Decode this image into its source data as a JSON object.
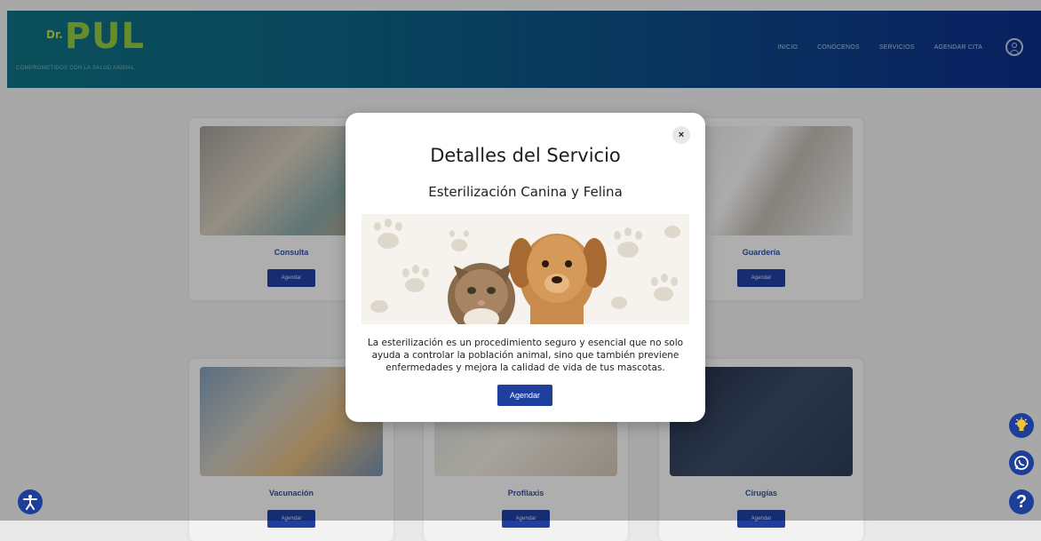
{
  "header": {
    "logo_prefix": "Dr.",
    "logo_text": "PUL",
    "tagline": "COMPROMETIDOS CON LA SALUD ANIMAL",
    "nav": [
      "INICIO",
      "CONÓCENOS",
      "SERVICIOS",
      "AGENDAR CITA"
    ]
  },
  "cards": [
    {
      "title": "Consulta",
      "button": "Agendar"
    },
    {
      "title": "Guardería",
      "button": "Agendar"
    },
    {
      "title": "Vacunación",
      "button": "Agendar"
    },
    {
      "title": "Profilaxis",
      "button": "Agendar"
    },
    {
      "title": "Cirugías",
      "button": "Agendar"
    }
  ],
  "modal": {
    "close_label": "×",
    "title": "Detalles del Servicio",
    "subtitle": "Esterilización Canina y Felina",
    "description": "La esterilización es un procedimiento seguro y esencial que no solo ayuda a controlar la población animal, sino que también previene enfermedades y mejora la calidad de vida de tus mascotas.",
    "button": "Agendar"
  },
  "floating": {
    "help_label": "?"
  },
  "colors": {
    "accent": "#1f3f9e",
    "header_start": "#0f6e7e",
    "header_end": "#0d2d86",
    "logo_green": "#8fc23b"
  },
  "icons": [
    "user-icon",
    "accessibility-icon",
    "lightbulb-icon",
    "whatsapp-icon",
    "help-icon",
    "close-icon"
  ]
}
